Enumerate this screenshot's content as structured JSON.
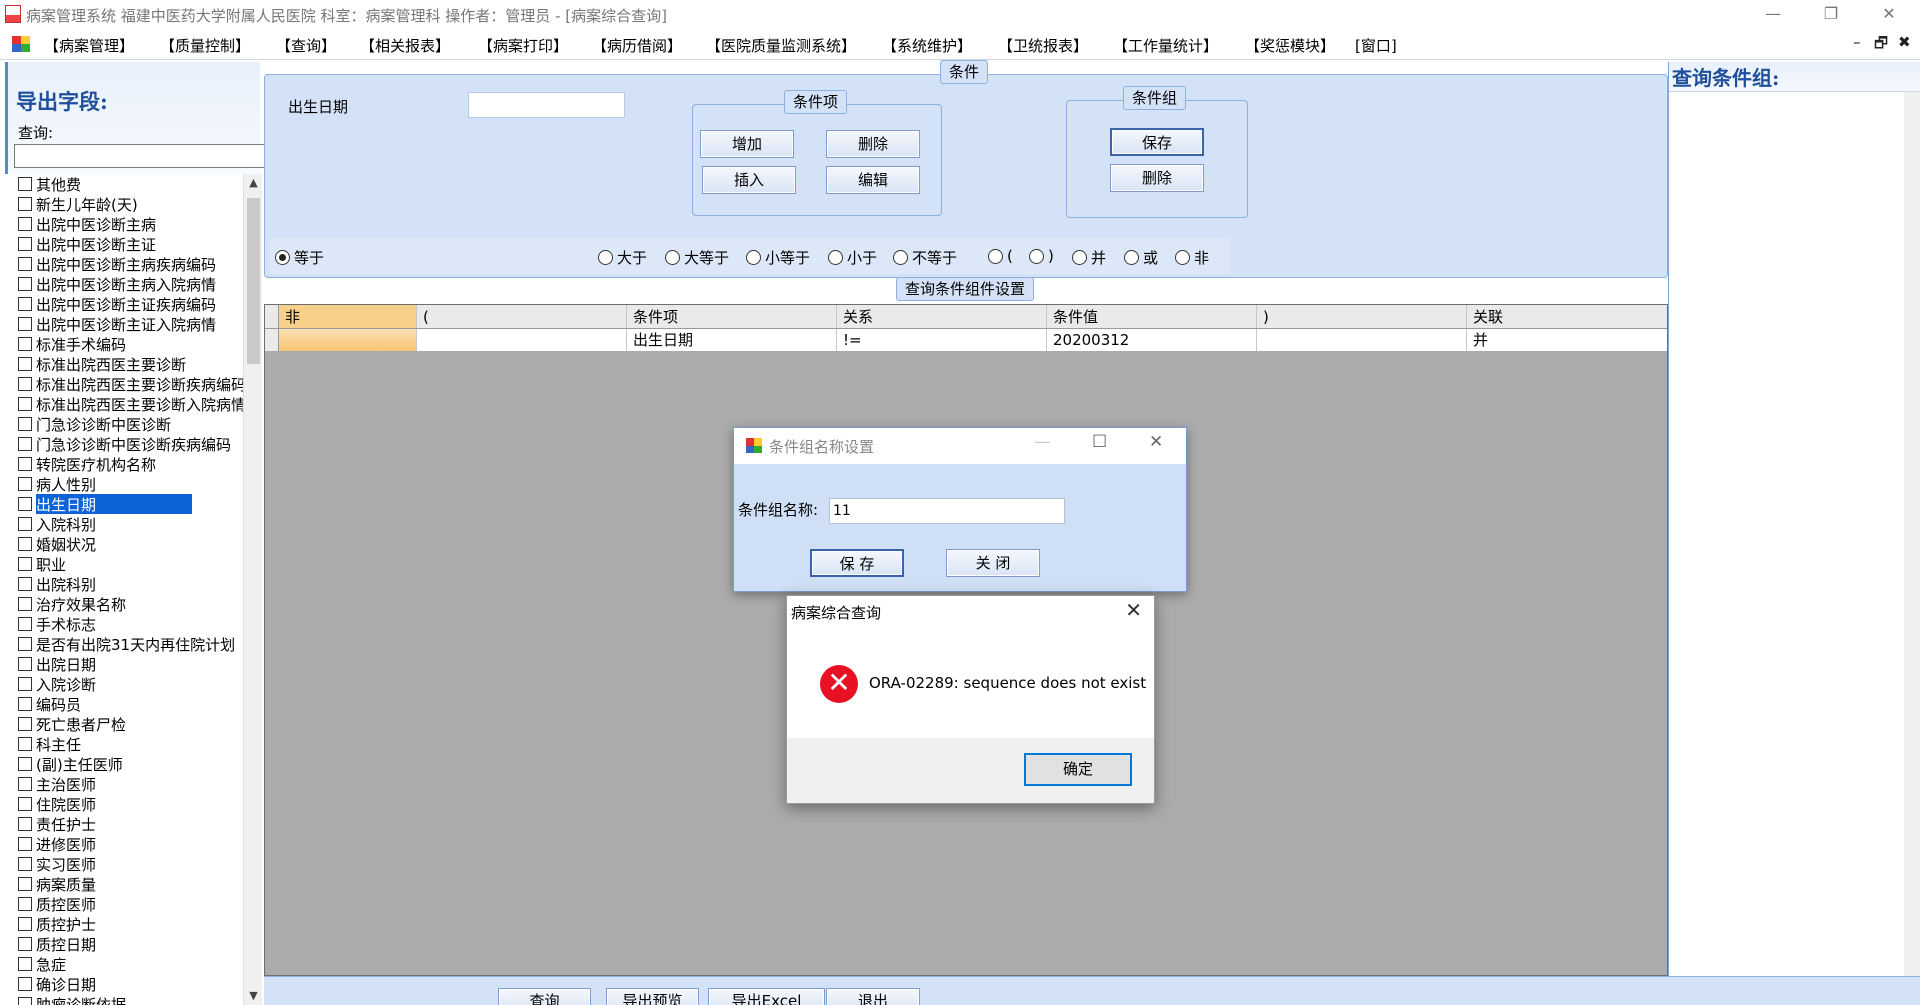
{
  "window": {
    "title": "病案管理系统 福建中医药大学附属人民医院 科室：病案管理科 操作者：管理员 - [病案综合查询]",
    "minimize": "—",
    "restore": "❐",
    "close": "✕"
  },
  "menu": {
    "items": [
      "【病案管理】",
      "【质量控制】",
      "【查询】",
      "【相关报表】",
      "【病案打印】",
      "【病历借阅】",
      "【医院质量监测系统】",
      "【系统维护】",
      "【卫统报表】",
      "【工作量统计】",
      "【奖惩模块】",
      "[窗口]"
    ],
    "mdi_min": "–",
    "mdi_restore": "🗗",
    "mdi_close": "✖"
  },
  "left_panel": {
    "title": "导出字段:",
    "query_label": "查询:",
    "query_value": "",
    "selected_index": 16,
    "scroll_up": "▲",
    "scroll_down": "▼",
    "fields": [
      "其他费",
      "新生儿年龄(天)",
      "出院中医诊断主病",
      "出院中医诊断主证",
      "出院中医诊断主病疾病编码",
      "出院中医诊断主病入院病情",
      "出院中医诊断主证疾病编码",
      "出院中医诊断主证入院病情",
      "标准手术编码",
      "标准出院西医主要诊断",
      "标准出院西医主要诊断疾病编码",
      "标准出院西医主要诊断入院病情",
      "门急诊诊断中医诊断",
      "门急诊诊断中医诊断疾病编码",
      "转院医疗机构名称",
      "病人性别",
      "出生日期",
      "入院科别",
      "婚姻状况",
      "职业",
      "出院科别",
      "治疗效果名称",
      "手术标志",
      "是否有出院31天内再住院计划",
      "出院日期",
      "入院诊断",
      "编码员",
      "死亡患者尸检",
      "科主任",
      "(副)主任医师",
      "主治医师",
      "住院医师",
      "责任护士",
      "进修医师",
      "实习医师",
      "病案质量",
      "质控医师",
      "质控护士",
      "质控日期",
      "急症",
      "确诊日期",
      "肿瘤诊断依据"
    ]
  },
  "condition_panel": {
    "caption": "条件",
    "date_label": "出生日期",
    "date_value": "",
    "item_group": {
      "caption": "条件项",
      "add": "增加",
      "delete": "删除",
      "insert": "插入",
      "edit": "编辑"
    },
    "group_group": {
      "caption": "条件组",
      "save": "保存",
      "delete": "删除"
    },
    "operators": [
      "等于",
      "大于",
      "大等于",
      "小等于",
      "小于",
      "不等于",
      "(",
      ")",
      "并",
      "或",
      "非"
    ],
    "selected_operator": "等于"
  },
  "grid": {
    "caption": "查询条件组件设置",
    "columns": [
      "非",
      "(",
      "条件项",
      "关系",
      "条件值",
      ")",
      "关联"
    ],
    "rows": [
      [
        "",
        "",
        "出生日期",
        "!=",
        "20200312",
        "",
        "并"
      ]
    ]
  },
  "right_panel": {
    "title": "查询条件组:"
  },
  "bottom_buttons": [
    "查询",
    "导出预览",
    "导出Excel",
    "退出"
  ],
  "dialog_group_name": {
    "title": "条件组名称设置",
    "minimize": "—",
    "maximize": "☐",
    "close": "✕",
    "label": "条件组名称:",
    "value": "11",
    "save": "保 存",
    "close_btn": "关 闭"
  },
  "message_box": {
    "title": "病案综合查询",
    "close": "✕",
    "icon": "✕",
    "text": "ORA-02289: sequence does not exist",
    "ok": "确定"
  }
}
